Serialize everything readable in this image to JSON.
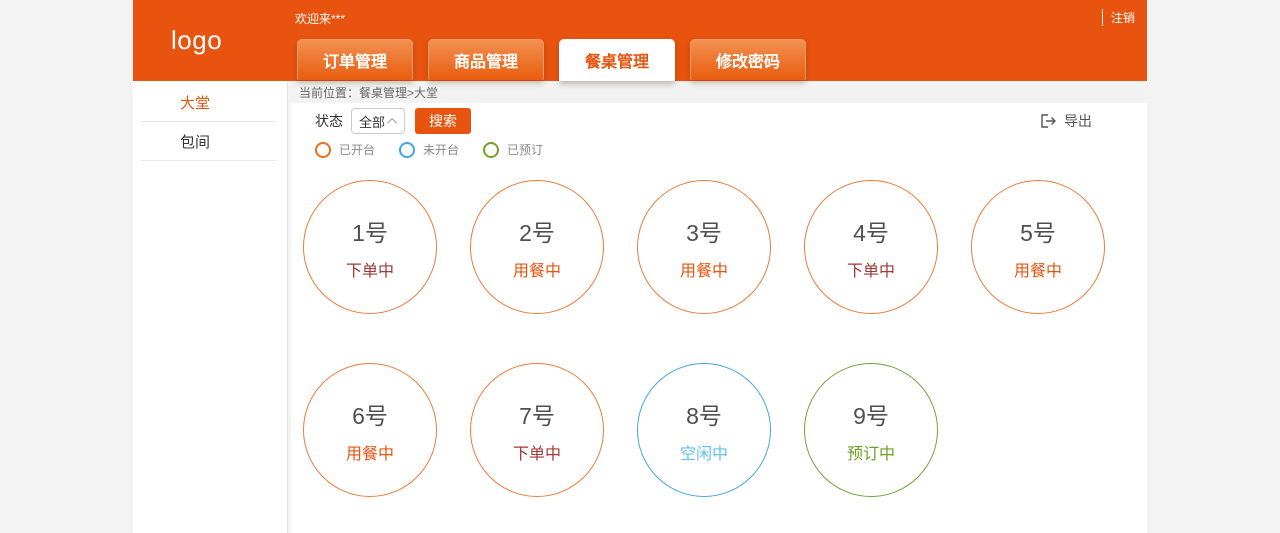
{
  "colors": {
    "primary": "#e8540f",
    "page_bg": "#f3f3f3",
    "status_ordering": "#a03a36",
    "status_dining": "#e8540f",
    "status_idle": "#62c2ef",
    "status_reserved": "#6f9f27"
  },
  "header": {
    "logo": "logo",
    "welcome": "欢迎来***",
    "logout": "注销",
    "tabs": [
      {
        "label": "订单管理"
      },
      {
        "label": "商品管理"
      },
      {
        "label": "餐桌管理"
      },
      {
        "label": "修改密码"
      }
    ]
  },
  "sidebar": {
    "items": [
      {
        "label": "大堂"
      },
      {
        "label": "包间"
      }
    ]
  },
  "main": {
    "breadcrumb": "当前位置：餐桌管理>大堂",
    "filter": {
      "status_label": "状态",
      "status_value": "全部",
      "search_label": "搜索"
    },
    "export_label": "导出",
    "legend": [
      {
        "label": "已开台",
        "color": "#e8701f"
      },
      {
        "label": "未开台",
        "color": "#3ba6e9"
      },
      {
        "label": "已预订",
        "color": "#74a226"
      }
    ],
    "tables": [
      {
        "name": "1号",
        "status": "下单中",
        "status_color": "#a03a36",
        "border_color": "#ec7c3c"
      },
      {
        "name": "2号",
        "status": "用餐中",
        "status_color": "#e8540f",
        "border_color": "#ec7c3c"
      },
      {
        "name": "3号",
        "status": "用餐中",
        "status_color": "#e8540f",
        "border_color": "#ec7c3c"
      },
      {
        "name": "4号",
        "status": "下单中",
        "status_color": "#a03a36",
        "border_color": "#ec7c3c"
      },
      {
        "name": "5号",
        "status": "用餐中",
        "status_color": "#e8540f",
        "border_color": "#ec7c3c"
      },
      {
        "name": "6号",
        "status": "用餐中",
        "status_color": "#e8540f",
        "border_color": "#ec7c3c"
      },
      {
        "name": "7号",
        "status": "下单中",
        "status_color": "#a03a36",
        "border_color": "#ec7c3c"
      },
      {
        "name": "8号",
        "status": "空闲中",
        "status_color": "#62c2ef",
        "border_color": "#45a6e2"
      },
      {
        "name": "9号",
        "status": "预订中",
        "status_color": "#6f9f27",
        "border_color": "#78a23b"
      }
    ]
  }
}
